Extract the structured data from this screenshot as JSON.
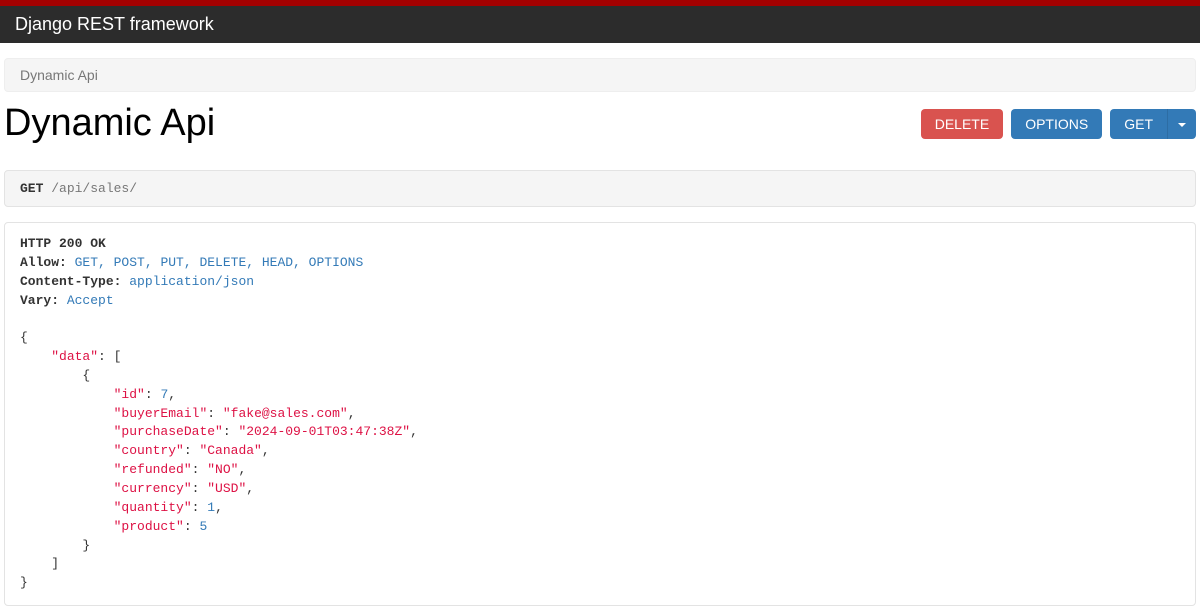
{
  "navbar": {
    "brand": "Django REST framework"
  },
  "breadcrumb": {
    "current": "Dynamic Api"
  },
  "page": {
    "title": "Dynamic Api"
  },
  "buttons": {
    "delete": "DELETE",
    "options": "OPTIONS",
    "get": "GET"
  },
  "request": {
    "method": "GET",
    "path": "/api/sales/"
  },
  "response": {
    "status_line": "HTTP 200 OK",
    "headers": {
      "allow_label": "Allow:",
      "allow_value": "GET, POST, PUT, DELETE, HEAD, OPTIONS",
      "content_type_label": "Content-Type:",
      "content_type_value": "application/json",
      "vary_label": "Vary:",
      "vary_value": "Accept"
    },
    "body": {
      "data": [
        {
          "id": 7,
          "buyerEmail": "fake@sales.com",
          "purchaseDate": "2024-09-01T03:47:38Z",
          "country": "Canada",
          "refunded": "NO",
          "currency": "USD",
          "quantity": 1,
          "product": 5
        }
      ]
    }
  }
}
